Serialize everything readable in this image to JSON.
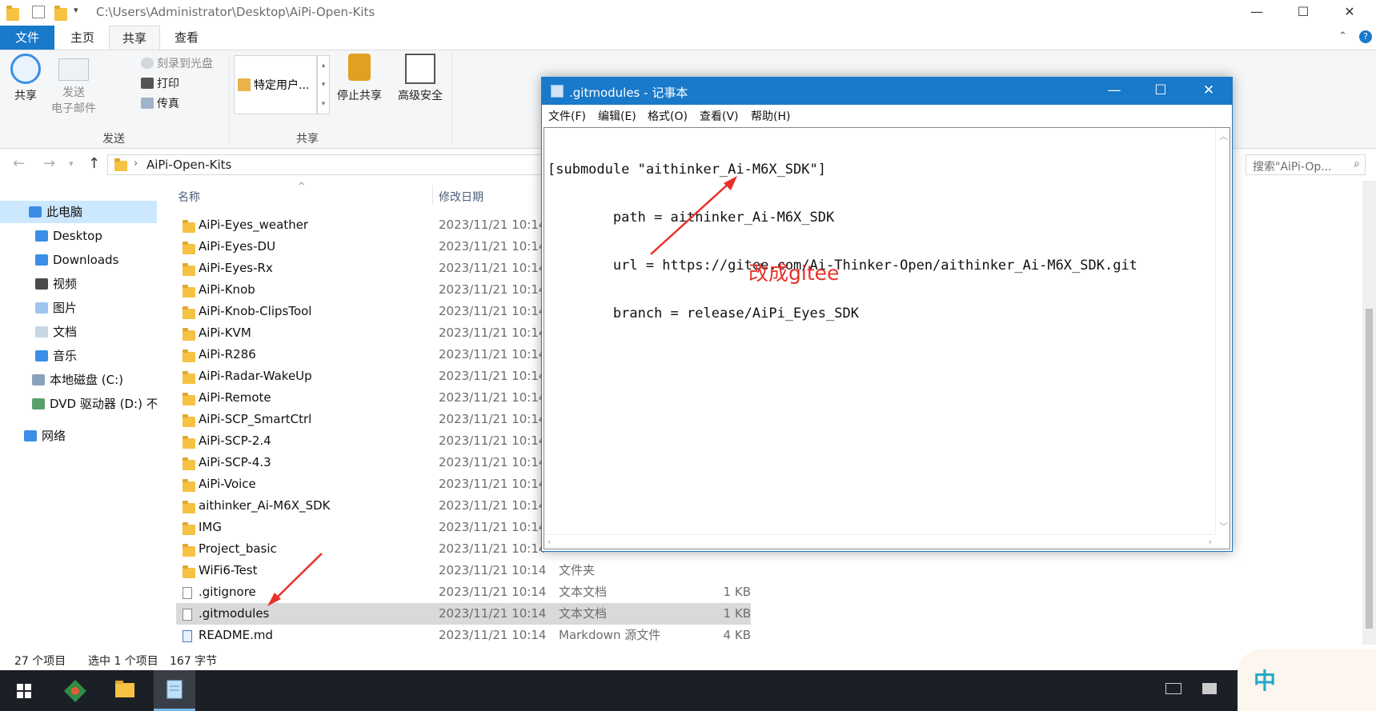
{
  "explorer": {
    "title_path": "C:\\Users\\Administrator\\Desktop\\AiPi-Open-Kits",
    "window_controls": {
      "minimize": "—",
      "maximize": "☐",
      "close": "✕"
    },
    "tabs": [
      "文件",
      "主页",
      "共享",
      "查看"
    ],
    "active_tab": "共享",
    "ribbon": {
      "share_label": "共享",
      "send_email_line1": "发送",
      "send_email_line2": "电子邮件",
      "burn_disc": "刻录到光盘",
      "print": "打印",
      "fax": "传真",
      "group_send": "发送",
      "specific_users": "特定用户...",
      "stop_sharing": "停止共享",
      "advanced_security": "高级安全",
      "group_share": "共享"
    },
    "address": {
      "current": "AiPi-Open-Kits",
      "search_placeholder": "搜索\"AiPi-Op..."
    },
    "nav": {
      "this_pc": "此电脑",
      "items": [
        "Desktop",
        "Downloads",
        "视频",
        "图片",
        "文档",
        "音乐",
        "本地磁盘 (C:)",
        "DVD 驱动器 (D:) 不"
      ],
      "network": "网络"
    },
    "columns": {
      "name": "名称",
      "modified": "修改日期"
    },
    "files": [
      {
        "name": "AiPi-Eyes_weather",
        "date": "2023/11/21 10:14",
        "type": "",
        "size": "",
        "kind": "folder"
      },
      {
        "name": "AiPi-Eyes-DU",
        "date": "2023/11/21 10:14",
        "type": "",
        "size": "",
        "kind": "folder"
      },
      {
        "name": "AiPi-Eyes-Rx",
        "date": "2023/11/21 10:14",
        "type": "",
        "size": "",
        "kind": "folder"
      },
      {
        "name": "AiPi-Knob",
        "date": "2023/11/21 10:14",
        "type": "",
        "size": "",
        "kind": "folder"
      },
      {
        "name": "AiPi-Knob-ClipsTool",
        "date": "2023/11/21 10:14",
        "type": "",
        "size": "",
        "kind": "folder"
      },
      {
        "name": "AiPi-KVM",
        "date": "2023/11/21 10:14",
        "type": "",
        "size": "",
        "kind": "folder"
      },
      {
        "name": "AiPi-R286",
        "date": "2023/11/21 10:14",
        "type": "",
        "size": "",
        "kind": "folder"
      },
      {
        "name": "AiPi-Radar-WakeUp",
        "date": "2023/11/21 10:14",
        "type": "",
        "size": "",
        "kind": "folder"
      },
      {
        "name": "AiPi-Remote",
        "date": "2023/11/21 10:14",
        "type": "",
        "size": "",
        "kind": "folder"
      },
      {
        "name": "AiPi-SCP_SmartCtrl",
        "date": "2023/11/21 10:14",
        "type": "",
        "size": "",
        "kind": "folder"
      },
      {
        "name": "AiPi-SCP-2.4",
        "date": "2023/11/21 10:14",
        "type": "",
        "size": "",
        "kind": "folder"
      },
      {
        "name": "AiPi-SCP-4.3",
        "date": "2023/11/21 10:14",
        "type": "",
        "size": "",
        "kind": "folder"
      },
      {
        "name": "AiPi-Voice",
        "date": "2023/11/21 10:14",
        "type": "",
        "size": "",
        "kind": "folder"
      },
      {
        "name": "aithinker_Ai-M6X_SDK",
        "date": "2023/11/21 10:14",
        "type": "",
        "size": "",
        "kind": "folder"
      },
      {
        "name": "IMG",
        "date": "2023/11/21 10:14",
        "type": "",
        "size": "",
        "kind": "folder"
      },
      {
        "name": "Project_basic",
        "date": "2023/11/21 10:14",
        "type": "",
        "size": "",
        "kind": "folder"
      },
      {
        "name": "WiFi6-Test",
        "date": "2023/11/21 10:14",
        "type": "文件夹",
        "size": "",
        "kind": "folder"
      },
      {
        "name": ".gitignore",
        "date": "2023/11/21 10:14",
        "type": "文本文档",
        "size": "1 KB",
        "kind": "doc"
      },
      {
        "name": ".gitmodules",
        "date": "2023/11/21 10:14",
        "type": "文本文档",
        "size": "1 KB",
        "kind": "doc",
        "selected": true
      },
      {
        "name": "README.md",
        "date": "2023/11/21 10:14",
        "type": "Markdown 源文件",
        "size": "4 KB",
        "kind": "md"
      }
    ],
    "status": {
      "items": "27 个项目",
      "selected": "选中 1 个项目",
      "size": "167 字节"
    }
  },
  "notepad": {
    "title": ".gitmodules - 记事本",
    "menu": [
      "文件(F)",
      "编辑(E)",
      "格式(O)",
      "查看(V)",
      "帮助(H)"
    ],
    "lines": [
      "[submodule \"aithinker_Ai-M6X_SDK\"]",
      "\tpath = aithinker_Ai-M6X_SDK",
      "\turl = https://gitee.com/Ai-Thinker-Open/aithinker_Ai-M6X_SDK.git",
      "\tbranch = release/AiPi_Eyes_SDK"
    ]
  },
  "annotation": {
    "text": "改成gitee",
    "color": "#e8312a"
  },
  "watermark": {
    "text": "中"
  },
  "colors": {
    "accent": "#1979ca",
    "selection": "#cce8ff",
    "taskbar": "#1b1f26"
  }
}
